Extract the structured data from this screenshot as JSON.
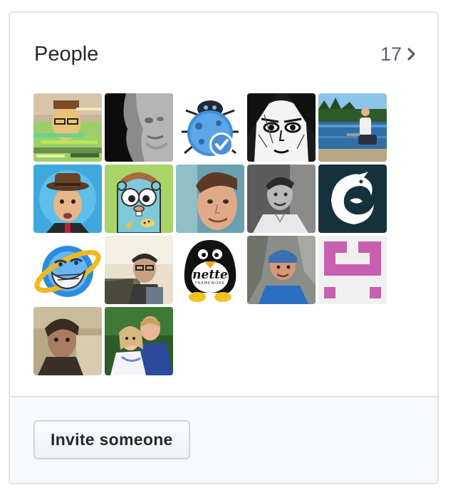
{
  "people_card": {
    "title": "People",
    "count": "17",
    "avatars": [
      {
        "name": "avatar-glitch-portrait"
      },
      {
        "name": "avatar-stone-statue"
      },
      {
        "name": "avatar-blue-ladybug"
      },
      {
        "name": "avatar-manga-face"
      },
      {
        "name": "avatar-lake-sitting"
      },
      {
        "name": "avatar-hat-man"
      },
      {
        "name": "avatar-gopher"
      },
      {
        "name": "avatar-smiling-man"
      },
      {
        "name": "avatar-bw-man"
      },
      {
        "name": "avatar-phoenix-logo"
      },
      {
        "name": "avatar-trollface-ie"
      },
      {
        "name": "avatar-man-sunlight"
      },
      {
        "name": "avatar-nette-penguin"
      },
      {
        "name": "avatar-climber"
      },
      {
        "name": "avatar-pink-identicon"
      },
      {
        "name": "avatar-sepia-portrait"
      },
      {
        "name": "avatar-couple"
      }
    ],
    "invite_label": "Invite someone",
    "nette_text": "nette",
    "nette_subtext": "FRAMEWORK"
  }
}
